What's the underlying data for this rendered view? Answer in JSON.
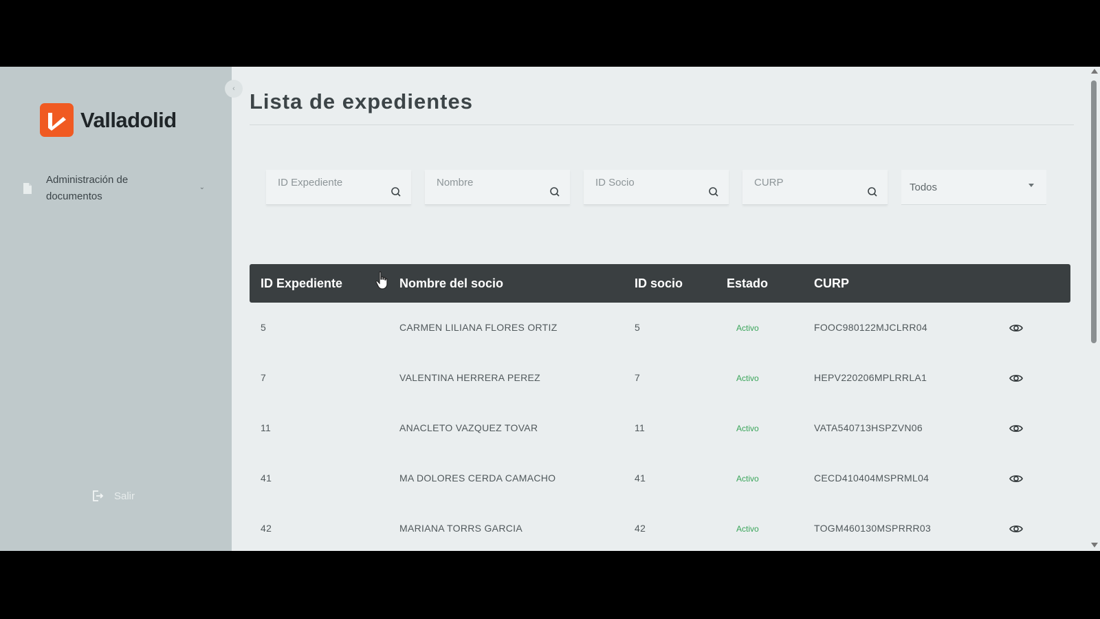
{
  "sidebar": {
    "logo_text": "Valladolid",
    "brand_color": "#f05a22",
    "nav_items": [
      {
        "label": "Administración de documentos",
        "icon": "document-icon"
      }
    ],
    "logout_label": "Salir"
  },
  "page": {
    "title": "Lista de expedientes"
  },
  "filters": {
    "id_expediente_placeholder": "ID Expediente",
    "nombre_placeholder": "Nombre",
    "id_socio_placeholder": "ID Socio",
    "curp_placeholder": "CURP",
    "status_select_value": "Todos"
  },
  "table": {
    "headers": [
      "ID Expediente",
      "Nombre del socio",
      "ID socio",
      "Estado",
      "CURP"
    ],
    "rows": [
      {
        "id_expediente": "5",
        "nombre": "CARMEN LILIANA FLORES ORTIZ",
        "id_socio": "5",
        "estado": "Activo",
        "curp": "FOOC980122MJCLRR04"
      },
      {
        "id_expediente": "7",
        "nombre": "VALENTINA HERRERA PEREZ",
        "id_socio": "7",
        "estado": "Activo",
        "curp": "HEPV220206MPLRRLA1"
      },
      {
        "id_expediente": "11",
        "nombre": "ANACLETO VAZQUEZ TOVAR",
        "id_socio": "11",
        "estado": "Activo",
        "curp": "VATA540713HSPZVN06"
      },
      {
        "id_expediente": "41",
        "nombre": "MA DOLORES CERDA CAMACHO",
        "id_socio": "41",
        "estado": "Activo",
        "curp": "CECD410404MSPRML04"
      },
      {
        "id_expediente": "42",
        "nombre": "MARIANA TORRS GARCIA",
        "id_socio": "42",
        "estado": "Activo",
        "curp": "TOGM460130MSPRRR03"
      }
    ]
  }
}
